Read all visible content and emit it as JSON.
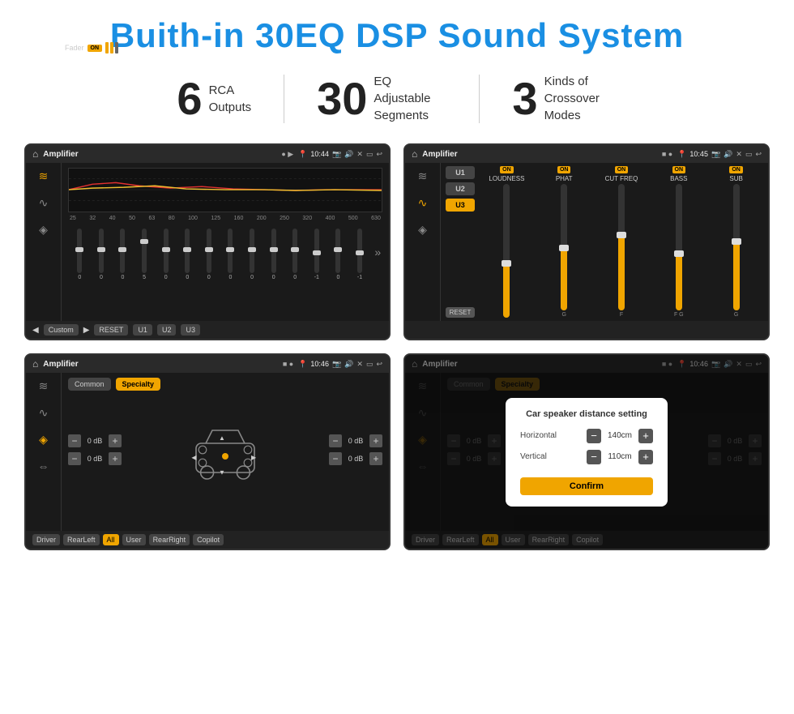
{
  "page": {
    "title": "Buith-in 30EQ DSP Sound System",
    "stats": [
      {
        "number": "6",
        "label": "RCA\nOutputs"
      },
      {
        "number": "30",
        "label": "EQ Adjustable\nSegments"
      },
      {
        "number": "3",
        "label": "Kinds of\nCrossover Modes"
      }
    ]
  },
  "screens": {
    "screen1": {
      "topbar": {
        "title": "Amplifier",
        "time": "10:44"
      },
      "eq_bands": [
        "25",
        "32",
        "40",
        "50",
        "63",
        "80",
        "100",
        "125",
        "160",
        "200",
        "250",
        "320",
        "400",
        "500",
        "630"
      ],
      "eq_values": [
        "0",
        "0",
        "0",
        "5",
        "0",
        "0",
        "0",
        "0",
        "0",
        "0",
        "0",
        "-1",
        "0",
        "-1"
      ],
      "eq_preset": "Custom",
      "buttons": [
        "RESET",
        "U1",
        "U2",
        "U3"
      ]
    },
    "screen2": {
      "topbar": {
        "title": "Amplifier",
        "time": "10:45"
      },
      "presets": [
        "U1",
        "U2",
        "U3"
      ],
      "channels": [
        {
          "name": "LOUDNESS",
          "on": true
        },
        {
          "name": "PHAT",
          "on": true
        },
        {
          "name": "CUT FREQ",
          "on": true
        },
        {
          "name": "BASS",
          "on": true
        },
        {
          "name": "SUB",
          "on": true
        }
      ],
      "reset": "RESET"
    },
    "screen3": {
      "topbar": {
        "title": "Amplifier",
        "time": "10:46"
      },
      "tabs": [
        "Common",
        "Specialty"
      ],
      "fader_label": "Fader",
      "fader_on": "ON",
      "volumes": [
        {
          "label": "0 dB"
        },
        {
          "label": "0 dB"
        },
        {
          "label": "0 dB"
        },
        {
          "label": "0 dB"
        }
      ],
      "bottom_btns": [
        "Driver",
        "RearLeft",
        "All",
        "User",
        "RearRight",
        "Copilot"
      ]
    },
    "screen4": {
      "topbar": {
        "title": "Amplifier",
        "time": "10:46"
      },
      "tabs": [
        "Common",
        "Specialty"
      ],
      "dialog": {
        "title": "Car speaker distance setting",
        "horizontal_label": "Horizontal",
        "horizontal_value": "140cm",
        "vertical_label": "Vertical",
        "vertical_value": "110cm",
        "confirm_label": "Confirm"
      },
      "bottom_btns": [
        "Driver",
        "RearLeft",
        "All",
        "User",
        "RearRight",
        "Copilot"
      ]
    }
  },
  "icons": {
    "home": "⌂",
    "play": "▶",
    "pause": "⏸",
    "settings": "⚙",
    "speaker": "🔊",
    "location": "📍",
    "back": "↩",
    "eq": "≋",
    "wave": "∿",
    "arrows": "⇔"
  }
}
